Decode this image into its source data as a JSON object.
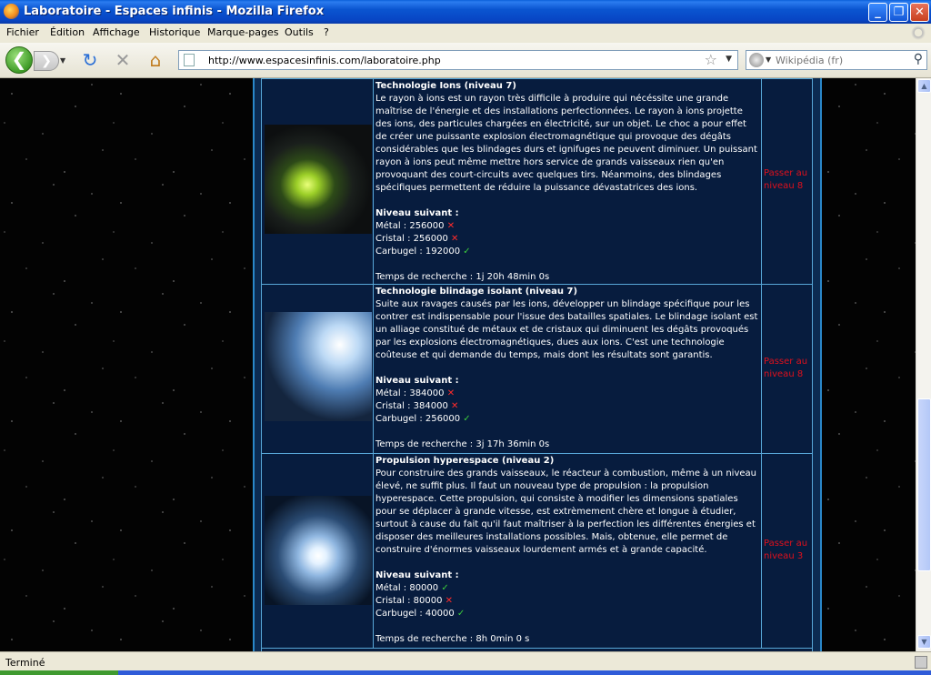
{
  "window": {
    "title": "Laboratoire - Espaces infinis - Mozilla Firefox",
    "minimize": "_",
    "maximize": "❐",
    "close": "✕"
  },
  "menu": {
    "items": [
      "Fichier",
      "Édition",
      "Affichage",
      "Historique",
      "Marque-pages",
      "Outils",
      "?"
    ]
  },
  "nav": {
    "back_icon": "arrow-left-icon",
    "forward_icon": "arrow-right-icon",
    "back_glyph": "❮",
    "forward_glyph": "❯",
    "reload_glyph": "↻",
    "stop_glyph": "✕",
    "home_glyph": "⌂",
    "url": "http://www.espacesinfinis.com/laboratoire.php",
    "search_placeholder": "Wikipédia (fr)"
  },
  "colors": {
    "panel_bg": "#071c3e",
    "border": "#58a7d8",
    "action_red": "#e0101c",
    "ok_green": "#3ccc3c",
    "ko_red": "#ff2b2b"
  },
  "research": [
    {
      "title": "Technologie Ions (niveau 7)",
      "description": "Le rayon à ions est un rayon très difficile à produire qui nécéssite une grande maîtrise de l'énergie et des installations perfectionnées. Le rayon à ions projette des ions, des particules chargées en électricité, sur un objet. Le choc a pour effet de créer une puissante explosion électromagnétique qui provoque des dégâts considérables que les blindages durs et ignifuges ne peuvent diminuer. Un puissant rayon à ions peut même mettre hors service de grands vaisseaux rien qu'en provoquant des court-circuits avec quelques tirs. Néanmoins, des blindages spécifiques permettent de réduire la puissance dévastatrices des ions.",
      "next_label": "Niveau suivant :",
      "costs": [
        {
          "label": "Métal : 256000",
          "ok": false,
          "mark": "✕"
        },
        {
          "label": "Cristal : 256000",
          "ok": false,
          "mark": "✕"
        },
        {
          "label": "Carbugel : 192000",
          "ok": true,
          "mark": "✓"
        }
      ],
      "time": "Temps de recherche : 1j 20h 48min 0s",
      "action_line1": "Passer au",
      "action_line2": "niveau 8"
    },
    {
      "title": "Technologie blindage isolant (niveau 7)",
      "description": "Suite aux ravages causés par les ions, développer un blindage spécifique pour les contrer est indispensable pour l'issue des batailles spatiales. Le blindage isolant est un alliage constitué de métaux et de cristaux qui diminuent les dégâts provoqués par les explosions électromagnétiques, dues aux ions. C'est une technologie coûteuse et qui demande du temps, mais dont les résultats sont garantis.",
      "next_label": "Niveau suivant :",
      "costs": [
        {
          "label": "Métal : 384000",
          "ok": false,
          "mark": "✕"
        },
        {
          "label": "Cristal : 384000",
          "ok": false,
          "mark": "✕"
        },
        {
          "label": "Carbugel : 256000",
          "ok": true,
          "mark": "✓"
        }
      ],
      "time": "Temps de recherche : 3j 17h 36min 0s",
      "action_line1": "Passer au",
      "action_line2": "niveau 8"
    },
    {
      "title": "Propulsion hyperespace (niveau 2)",
      "description": "Pour construire des grands vaisseaux, le réacteur à combustion, même à un niveau élevé, ne suffit plus. Il faut un nouveau type de propulsion : la propulsion hyperespace. Cette propulsion, qui consiste à modifier les dimensions spatiales pour se déplacer à grande vitesse, est extrèmement chère et longue à étudier, surtout à cause du fait qu'il faut maîtriser à la perfection les différentes énergies et disposer des meilleures installations possibles. Mais, obtenue, elle permet de construire d'énormes vaisseaux lourdement armés et à grande capacité.",
      "next_label": "Niveau suivant :",
      "costs": [
        {
          "label": "Métal : 80000",
          "ok": true,
          "mark": "✓"
        },
        {
          "label": "Cristal : 80000",
          "ok": false,
          "mark": "✕"
        },
        {
          "label": "Carbugel : 40000",
          "ok": true,
          "mark": "✓"
        }
      ],
      "time": "Temps de recherche : 8h 0min 0 s",
      "action_line1": "Passer au",
      "action_line2": "niveau 3"
    }
  ],
  "status": {
    "text": "Terminé"
  }
}
